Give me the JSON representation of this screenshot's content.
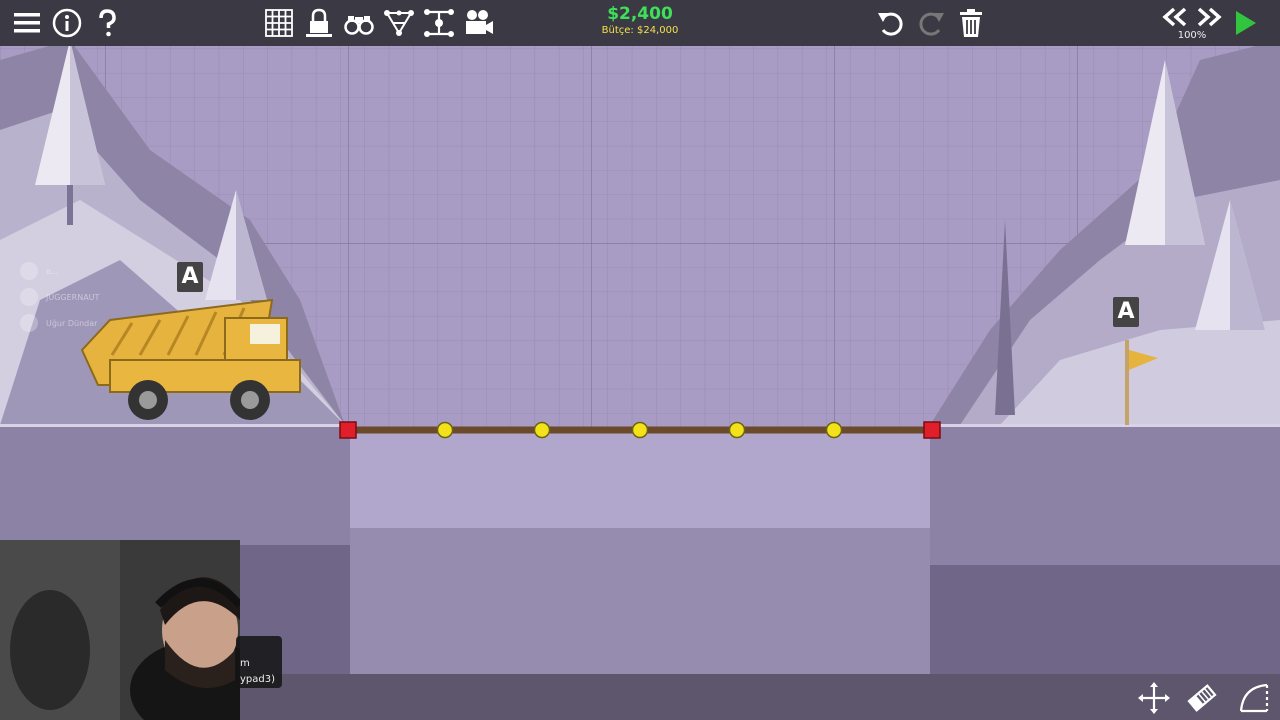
{
  "toolbar": {
    "cost": "$2,400",
    "budget": "Bütçe: $24,000",
    "zoom": "100%"
  },
  "level": {
    "start_sign": "A",
    "end_sign": "A"
  },
  "webcam_overlay": {
    "line1": "m",
    "line2": "ypad3)"
  },
  "chat": {
    "entries": [
      "o...",
      "JUGGERNAUT",
      "Uğur Dündar"
    ]
  },
  "colors": {
    "background": "#9b8fb8",
    "topbar": "#3b3a44",
    "cost": "#3ee05a",
    "budget": "#f3e14b",
    "anchor": "#e01f2b",
    "joint": "#f3e21b",
    "road": "#6b4a2b"
  },
  "icons": {
    "menu": "menu-icon",
    "info": "info-icon",
    "help": "help-icon",
    "grid": "grid-icon",
    "lock": "lock-icon",
    "binoculars": "binoculars-icon",
    "stress": "stress-icon",
    "split": "split-joints-icon",
    "camera": "camera-icon",
    "undo": "undo-icon",
    "redo": "redo-icon",
    "trash": "trash-icon",
    "rewind": "rewind-icon",
    "fastforward": "fastforward-icon",
    "play": "play-icon",
    "pan": "pan-icon",
    "eraser": "eraser-icon",
    "arc": "arc-tool-icon"
  }
}
